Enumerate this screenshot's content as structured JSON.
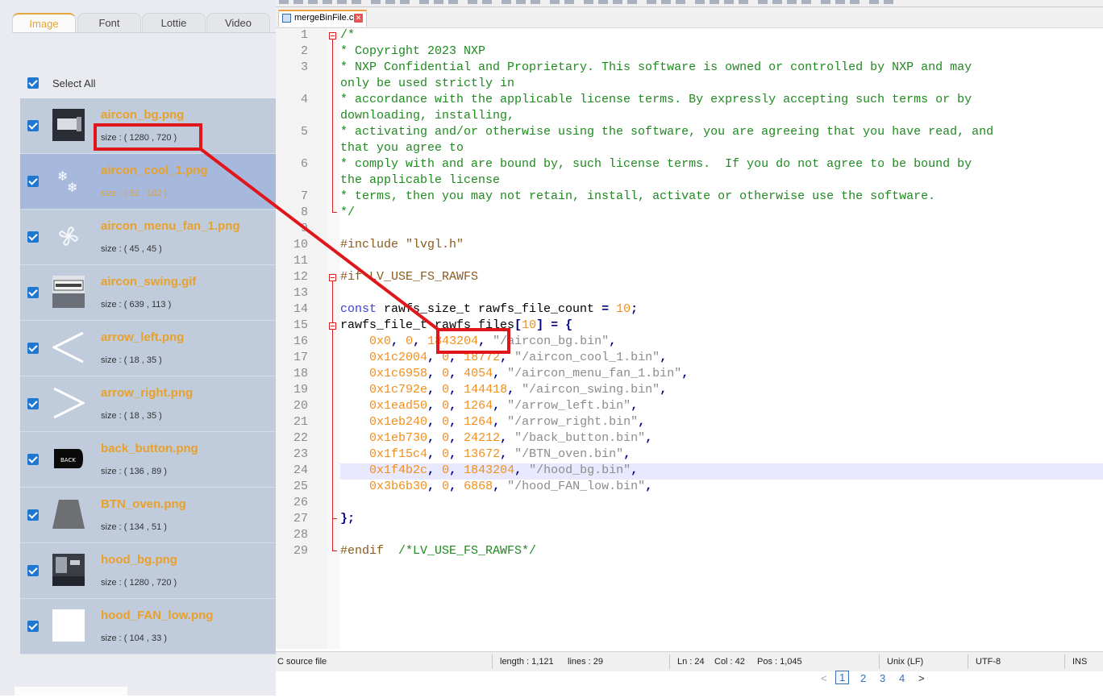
{
  "left_panel": {
    "tabs": [
      {
        "label": "Image",
        "active": true
      },
      {
        "label": "Font",
        "active": false
      },
      {
        "label": "Lottie",
        "active": false
      },
      {
        "label": "Video",
        "active": false
      }
    ],
    "select_all_label": "Select All",
    "assets": [
      {
        "name": "aircon_bg.png",
        "size": "size : ( 1280 , 720 )",
        "checked": true,
        "selected": false,
        "thumb_icon": "aircon-panel-thumbnail"
      },
      {
        "name": "aircon_cool_1.png",
        "size": "size : ( 92 , 102 )",
        "checked": true,
        "selected": true,
        "thumb_icon": "snowflake-thumbnail"
      },
      {
        "name": "aircon_menu_fan_1.png",
        "size": "size : ( 45 , 45 )",
        "checked": true,
        "selected": false,
        "thumb_icon": "fan-thumbnail"
      },
      {
        "name": "aircon_swing.gif",
        "size": "size : ( 639 , 113 )",
        "checked": true,
        "selected": false,
        "thumb_icon": "aircon-unit-thumbnail"
      },
      {
        "name": "arrow_left.png",
        "size": "size : ( 18 , 35 )",
        "checked": true,
        "selected": false,
        "thumb_icon": "arrow-left-thumbnail"
      },
      {
        "name": "arrow_right.png",
        "size": "size : ( 18 , 35 )",
        "checked": true,
        "selected": false,
        "thumb_icon": "arrow-right-thumbnail"
      },
      {
        "name": "back_button.png",
        "size": "size : ( 136 , 89 )",
        "checked": true,
        "selected": false,
        "thumb_icon": "back-button-thumbnail",
        "thumb_text": "BACK"
      },
      {
        "name": "BTN_oven.png",
        "size": "size : ( 134 , 51 )",
        "checked": true,
        "selected": false,
        "thumb_icon": "oven-button-thumbnail"
      },
      {
        "name": "hood_bg.png",
        "size": "size : ( 1280 , 720 )",
        "checked": true,
        "selected": false,
        "thumb_icon": "kitchen-hood-thumbnail"
      },
      {
        "name": "hood_FAN_low.png",
        "size": "size : ( 104 , 33 )",
        "checked": true,
        "selected": false,
        "thumb_icon": "white-blank-thumbnail"
      }
    ]
  },
  "editor": {
    "file_tab": "mergeBinFile.c",
    "close_glyph": "✕",
    "current_line": 24,
    "lines": [
      {
        "n": "1",
        "segs": [
          [
            "cm",
            "/*"
          ]
        ]
      },
      {
        "n": "2",
        "segs": [
          [
            "cm",
            "* Copyright 2023 NXP"
          ]
        ]
      },
      {
        "n": "3",
        "segs": [
          [
            "cm",
            "* NXP Confidential and Proprietary. This software is owned or controlled by NXP and may"
          ]
        ]
      },
      {
        "n": "",
        "segs": [
          [
            "cm",
            "only be used strictly in"
          ]
        ]
      },
      {
        "n": "4",
        "segs": [
          [
            "cm",
            "* accordance with the applicable license terms. By expressly accepting such terms or by"
          ]
        ]
      },
      {
        "n": "",
        "segs": [
          [
            "cm",
            "downloading, installing,"
          ]
        ]
      },
      {
        "n": "5",
        "segs": [
          [
            "cm",
            "* activating and/or otherwise using the software, you are agreeing that you have read, and"
          ]
        ]
      },
      {
        "n": "",
        "segs": [
          [
            "cm",
            "that you agree to"
          ]
        ]
      },
      {
        "n": "6",
        "segs": [
          [
            "cm",
            "* comply with and are bound by, such license terms.  If you do not agree to be bound by"
          ]
        ]
      },
      {
        "n": "",
        "segs": [
          [
            "cm",
            "the applicable license"
          ]
        ]
      },
      {
        "n": "7",
        "segs": [
          [
            "cm",
            "* terms, then you may not retain, install, activate or otherwise use the software."
          ]
        ]
      },
      {
        "n": "8",
        "segs": [
          [
            "cm",
            "*/"
          ]
        ]
      },
      {
        "n": "9",
        "segs": []
      },
      {
        "n": "10",
        "segs": [
          [
            "pp",
            "#include \"lvgl.h\""
          ]
        ]
      },
      {
        "n": "11",
        "segs": []
      },
      {
        "n": "12",
        "segs": [
          [
            "pp",
            "#if LV_USE_FS_RAWFS"
          ]
        ]
      },
      {
        "n": "13",
        "segs": []
      },
      {
        "n": "14",
        "segs": [
          [
            "kw",
            "const"
          ],
          [
            "tx",
            " rawfs_size_t rawfs_file_count "
          ],
          [
            "op",
            "="
          ],
          [
            "tx",
            " "
          ],
          [
            "nm",
            "10"
          ],
          [
            "op",
            ";"
          ]
        ]
      },
      {
        "n": "15",
        "segs": [
          [
            "tx",
            "rawfs_file_t rawfs_files"
          ],
          [
            "op",
            "["
          ],
          [
            "nm",
            "10"
          ],
          [
            "op",
            "]"
          ],
          [
            "tx",
            " "
          ],
          [
            "op",
            "="
          ],
          [
            "tx",
            " "
          ],
          [
            "op",
            "{"
          ]
        ]
      },
      {
        "n": "16",
        "segs": [
          [
            "tx",
            "    "
          ],
          [
            "nm",
            "0x0"
          ],
          [
            "op",
            ","
          ],
          [
            "tx",
            " "
          ],
          [
            "nm",
            "0"
          ],
          [
            "op",
            ","
          ],
          [
            "tx",
            " "
          ],
          [
            "nm",
            "1843204"
          ],
          [
            "op",
            ","
          ],
          [
            "tx",
            " "
          ],
          [
            "st",
            "\"/aircon_bg.bin\""
          ],
          [
            "op",
            ","
          ]
        ]
      },
      {
        "n": "17",
        "segs": [
          [
            "tx",
            "    "
          ],
          [
            "nm",
            "0x1c2004"
          ],
          [
            "op",
            ","
          ],
          [
            "tx",
            " "
          ],
          [
            "nm",
            "0"
          ],
          [
            "op",
            ","
          ],
          [
            "tx",
            " "
          ],
          [
            "nm",
            "18772"
          ],
          [
            "op",
            ","
          ],
          [
            "tx",
            " "
          ],
          [
            "st",
            "\"/aircon_cool_1.bin\""
          ],
          [
            "op",
            ","
          ]
        ]
      },
      {
        "n": "18",
        "segs": [
          [
            "tx",
            "    "
          ],
          [
            "nm",
            "0x1c6958"
          ],
          [
            "op",
            ","
          ],
          [
            "tx",
            " "
          ],
          [
            "nm",
            "0"
          ],
          [
            "op",
            ","
          ],
          [
            "tx",
            " "
          ],
          [
            "nm",
            "4054"
          ],
          [
            "op",
            ","
          ],
          [
            "tx",
            " "
          ],
          [
            "st",
            "\"/aircon_menu_fan_1.bin\""
          ],
          [
            "op",
            ","
          ]
        ]
      },
      {
        "n": "19",
        "segs": [
          [
            "tx",
            "    "
          ],
          [
            "nm",
            "0x1c792e"
          ],
          [
            "op",
            ","
          ],
          [
            "tx",
            " "
          ],
          [
            "nm",
            "0"
          ],
          [
            "op",
            ","
          ],
          [
            "tx",
            " "
          ],
          [
            "nm",
            "144418"
          ],
          [
            "op",
            ","
          ],
          [
            "tx",
            " "
          ],
          [
            "st",
            "\"/aircon_swing.bin\""
          ],
          [
            "op",
            ","
          ]
        ]
      },
      {
        "n": "20",
        "segs": [
          [
            "tx",
            "    "
          ],
          [
            "nm",
            "0x1ead50"
          ],
          [
            "op",
            ","
          ],
          [
            "tx",
            " "
          ],
          [
            "nm",
            "0"
          ],
          [
            "op",
            ","
          ],
          [
            "tx",
            " "
          ],
          [
            "nm",
            "1264"
          ],
          [
            "op",
            ","
          ],
          [
            "tx",
            " "
          ],
          [
            "st",
            "\"/arrow_left.bin\""
          ],
          [
            "op",
            ","
          ]
        ]
      },
      {
        "n": "21",
        "segs": [
          [
            "tx",
            "    "
          ],
          [
            "nm",
            "0x1eb240"
          ],
          [
            "op",
            ","
          ],
          [
            "tx",
            " "
          ],
          [
            "nm",
            "0"
          ],
          [
            "op",
            ","
          ],
          [
            "tx",
            " "
          ],
          [
            "nm",
            "1264"
          ],
          [
            "op",
            ","
          ],
          [
            "tx",
            " "
          ],
          [
            "st",
            "\"/arrow_right.bin\""
          ],
          [
            "op",
            ","
          ]
        ]
      },
      {
        "n": "22",
        "segs": [
          [
            "tx",
            "    "
          ],
          [
            "nm",
            "0x1eb730"
          ],
          [
            "op",
            ","
          ],
          [
            "tx",
            " "
          ],
          [
            "nm",
            "0"
          ],
          [
            "op",
            ","
          ],
          [
            "tx",
            " "
          ],
          [
            "nm",
            "24212"
          ],
          [
            "op",
            ","
          ],
          [
            "tx",
            " "
          ],
          [
            "st",
            "\"/back_button.bin\""
          ],
          [
            "op",
            ","
          ]
        ]
      },
      {
        "n": "23",
        "segs": [
          [
            "tx",
            "    "
          ],
          [
            "nm",
            "0x1f15c4"
          ],
          [
            "op",
            ","
          ],
          [
            "tx",
            " "
          ],
          [
            "nm",
            "0"
          ],
          [
            "op",
            ","
          ],
          [
            "tx",
            " "
          ],
          [
            "nm",
            "13672"
          ],
          [
            "op",
            ","
          ],
          [
            "tx",
            " "
          ],
          [
            "st",
            "\"/BTN_oven.bin\""
          ],
          [
            "op",
            ","
          ]
        ]
      },
      {
        "n": "24",
        "segs": [
          [
            "tx",
            "    "
          ],
          [
            "nm",
            "0x1f4b2c"
          ],
          [
            "op",
            ","
          ],
          [
            "tx",
            " "
          ],
          [
            "nm",
            "0"
          ],
          [
            "op",
            ","
          ],
          [
            "tx",
            " "
          ],
          [
            "nm",
            "1843204"
          ],
          [
            "op",
            ","
          ],
          [
            "tx",
            " "
          ],
          [
            "st",
            "\"/hood_bg.bin\""
          ],
          [
            "op",
            ","
          ]
        ]
      },
      {
        "n": "25",
        "segs": [
          [
            "tx",
            "    "
          ],
          [
            "nm",
            "0x3b6b30"
          ],
          [
            "op",
            ","
          ],
          [
            "tx",
            " "
          ],
          [
            "nm",
            "0"
          ],
          [
            "op",
            ","
          ],
          [
            "tx",
            " "
          ],
          [
            "nm",
            "6868"
          ],
          [
            "op",
            ","
          ],
          [
            "tx",
            " "
          ],
          [
            "st",
            "\"/hood_FAN_low.bin\""
          ],
          [
            "op",
            ","
          ]
        ]
      },
      {
        "n": "26",
        "segs": []
      },
      {
        "n": "27",
        "segs": [
          [
            "op",
            "};"
          ]
        ]
      },
      {
        "n": "28",
        "segs": []
      },
      {
        "n": "29",
        "segs": [
          [
            "pp",
            "#endif  "
          ],
          [
            "cm",
            "/*LV_USE_FS_RAWFS*/"
          ]
        ]
      }
    ]
  },
  "statusbar": {
    "file_type": "C source file",
    "length": "length : 1,121",
    "lines": "lines : 29",
    "ln": "Ln : 24",
    "col": "Col : 42",
    "pos": "Pos : 1,045",
    "eol": "Unix (LF)",
    "encoding": "UTF-8",
    "mode": "INS"
  },
  "pager": {
    "prev": "<",
    "pages": [
      "1",
      "2",
      "3",
      "4"
    ],
    "current": "1",
    "next": ">"
  },
  "colors": {
    "accent_orange": "#e8a12b",
    "annotation_red": "#e0161b",
    "checkbox_blue": "#1f77d0"
  }
}
